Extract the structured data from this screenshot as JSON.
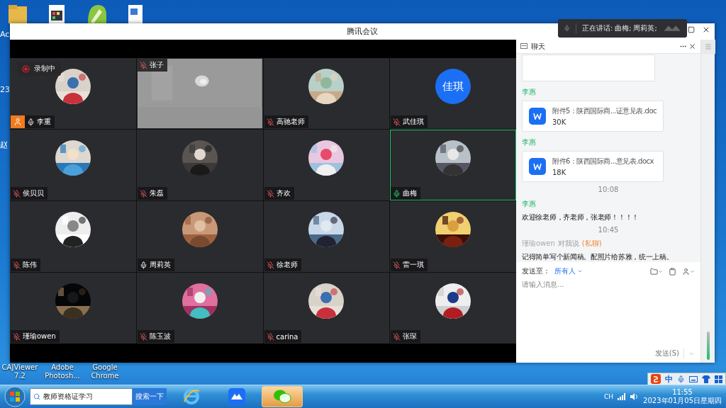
{
  "desktop": {
    "left_labels": [
      "Ac",
      "23",
      "赵"
    ],
    "bottom_icons": [
      "CAJViewer 7.2",
      "Adobe Photosh...",
      "Google Chrome"
    ]
  },
  "speaker_overlay": {
    "text": "正在讲话: 曲梅; 周莉英;"
  },
  "window": {
    "title": "腾讯会议"
  },
  "recording": {
    "label": "录制中"
  },
  "participants": [
    {
      "name": "李重",
      "muted": false,
      "speaking": false,
      "host": true,
      "active": false,
      "video": false
    },
    {
      "name": "张子",
      "muted": true,
      "speaking": false,
      "host": false,
      "active": false,
      "video": true
    },
    {
      "name": "高驰老师",
      "muted": true,
      "speaking": false,
      "host": false,
      "active": false,
      "video": false
    },
    {
      "name": "武佳琪",
      "muted": true,
      "speaking": false,
      "host": false,
      "active": false,
      "video": false,
      "avatar": {
        "kind": "initials",
        "text": "佳琪"
      }
    },
    {
      "name": "侯贝贝",
      "muted": true,
      "speaking": false,
      "host": false,
      "active": false,
      "video": false
    },
    {
      "name": "朱磊",
      "muted": true,
      "speaking": false,
      "host": false,
      "active": false,
      "video": false
    },
    {
      "name": "齐欢",
      "muted": true,
      "speaking": false,
      "host": false,
      "active": false,
      "video": false
    },
    {
      "name": "曲梅",
      "muted": false,
      "speaking": true,
      "host": false,
      "active": true,
      "video": false
    },
    {
      "name": "陈伟",
      "muted": true,
      "speaking": false,
      "host": false,
      "active": false,
      "video": false
    },
    {
      "name": "周莉英",
      "muted": false,
      "speaking": false,
      "host": false,
      "active": false,
      "video": false
    },
    {
      "name": "徐老师",
      "muted": true,
      "speaking": false,
      "host": false,
      "active": false,
      "video": false
    },
    {
      "name": "雷一琪",
      "muted": true,
      "speaking": false,
      "host": false,
      "active": false,
      "video": false
    },
    {
      "name": "瑾瑜owen",
      "muted": true,
      "speaking": false,
      "host": false,
      "active": false,
      "video": false
    },
    {
      "name": "陈玉波",
      "muted": true,
      "speaking": false,
      "host": false,
      "active": false,
      "video": false
    },
    {
      "name": "carina",
      "muted": true,
      "speaking": false,
      "host": false,
      "active": false,
      "video": false
    },
    {
      "name": "张琛",
      "muted": true,
      "speaking": false,
      "host": false,
      "active": false,
      "video": false
    }
  ],
  "chat": {
    "title": "聊天",
    "messages": [
      {
        "kind": "file_cut"
      },
      {
        "kind": "file",
        "sender": "李惠",
        "name": "附件5：陕西国际商...证意见表.doc",
        "size": "30K"
      },
      {
        "kind": "file",
        "sender": "李惠",
        "name": "附件6：陕西国际商...意见表.docx",
        "size": "18K"
      },
      {
        "kind": "time",
        "text": "10:08"
      },
      {
        "kind": "text",
        "sender": "李惠",
        "text": "欢迎徐老师，齐老师，张老师！！！！"
      },
      {
        "kind": "time",
        "text": "10:45"
      },
      {
        "kind": "private",
        "sender": "瑾瑜owen",
        "to": "对我说",
        "tag": "(私聊)",
        "text": "记得简单写个新闻稿。配照片给苏雅，统一上稿。"
      }
    ],
    "send_to_label": "发送至：",
    "send_to": "所有人",
    "placeholder": "请输入消息...",
    "send_button": "发送(S)"
  },
  "ime": {
    "label": "中"
  },
  "taskbar": {
    "search_value": "教师资格证学习",
    "search_button": "搜索一下",
    "apps": [
      {
        "kind": "ie",
        "selected": false
      },
      {
        "kind": "meeting",
        "selected": false
      },
      {
        "kind": "wechat",
        "selected": true
      }
    ],
    "lang": "CH",
    "time": "11:55",
    "date": "2023年01月05日星期四"
  }
}
